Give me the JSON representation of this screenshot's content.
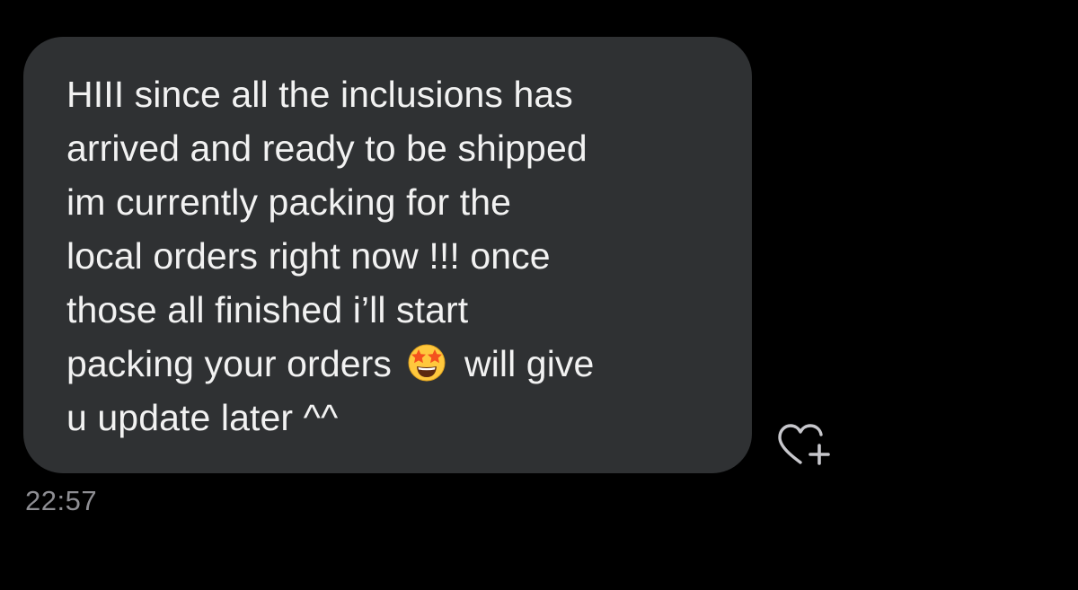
{
  "message": {
    "lines": [
      "HIII since all the inclusions has",
      "arrived and ready to be shipped",
      "im currently packing for the",
      "local orders right now !!! once",
      "those all finished i’ll start"
    ],
    "line6_before_emoji": "packing your orders",
    "emoji_icon": "star-struck-emoji",
    "line6_after_emoji": "will give",
    "line7": "u update later ^^",
    "timestamp": "22:57"
  },
  "colors": {
    "background": "#000000",
    "bubble": "#2f3133",
    "text": "#f2f2f2",
    "timestamp": "#8e8e93",
    "react_icon": "#c7c7cc"
  },
  "actions": {
    "react_icon": "heart-plus-icon"
  }
}
